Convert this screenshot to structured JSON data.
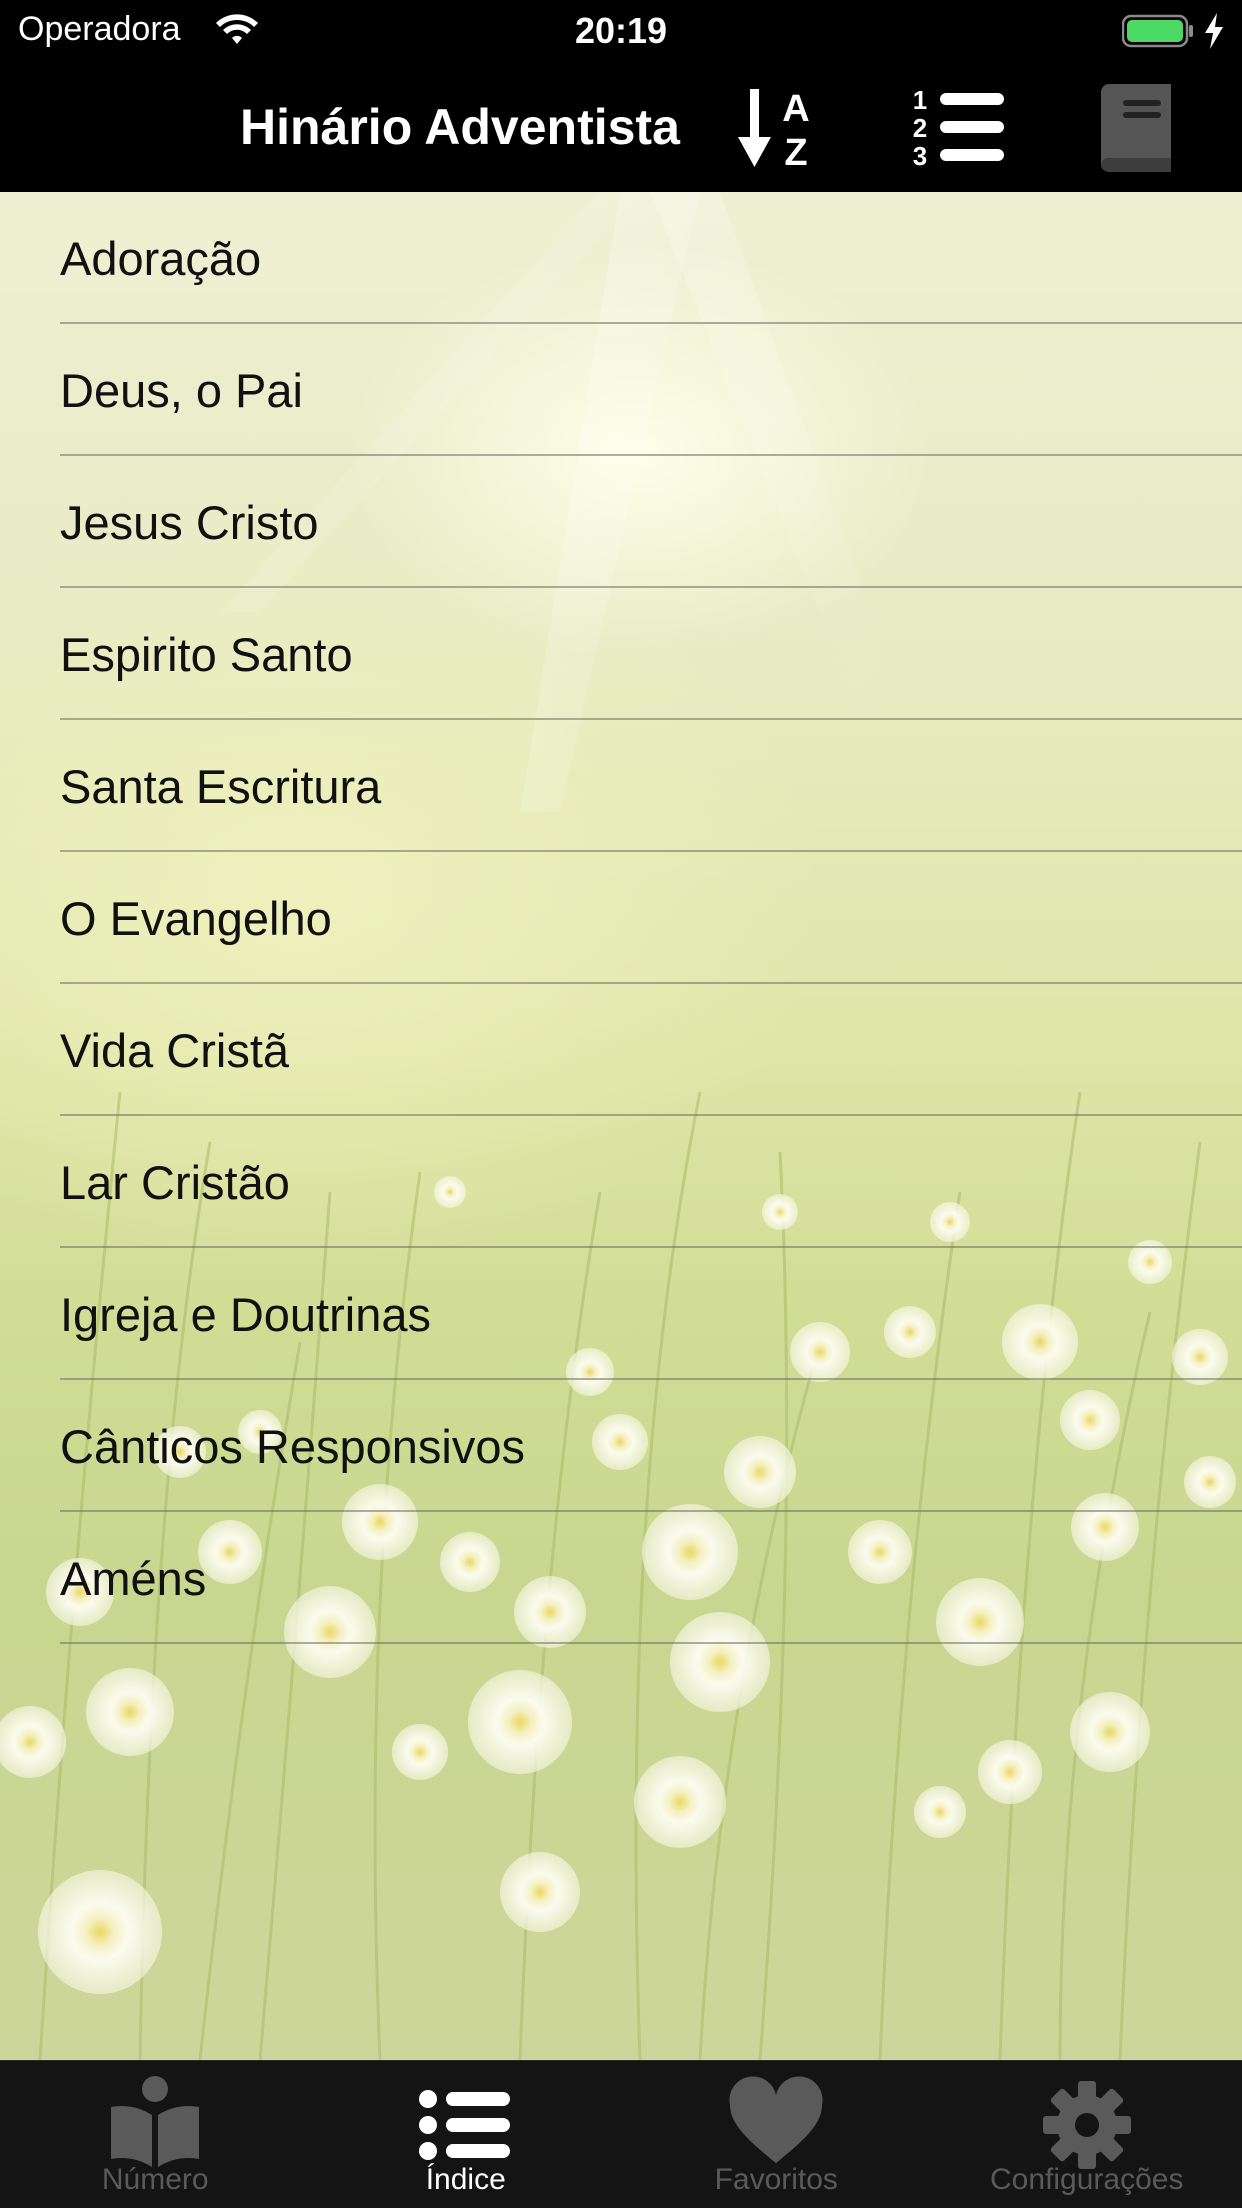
{
  "status_bar": {
    "carrier": "Operadora",
    "time": "20:19"
  },
  "nav": {
    "title": "Hinário Adventista",
    "sort_az_icon": "sort-alpha-icon",
    "sort_num_icon": "numbered-list-icon",
    "book_icon": "book-icon"
  },
  "categories": [
    {
      "label": "Adoração"
    },
    {
      "label": "Deus, o Pai"
    },
    {
      "label": "Jesus Cristo"
    },
    {
      "label": "Espirito Santo"
    },
    {
      "label": "Santa Escritura"
    },
    {
      "label": "O Evangelho"
    },
    {
      "label": "Vida Cristã"
    },
    {
      "label": "Lar Cristão"
    },
    {
      "label": "Igreja e Doutrinas"
    },
    {
      "label": "Cânticos Responsivos"
    },
    {
      "label": "Améns"
    }
  ],
  "tabs": [
    {
      "label": "Número",
      "icon": "open-book-icon",
      "active": false
    },
    {
      "label": "Índice",
      "icon": "list-icon",
      "active": true
    },
    {
      "label": "Favoritos",
      "icon": "heart-icon",
      "active": false
    },
    {
      "label": "Configurações",
      "icon": "gear-icon",
      "active": false
    }
  ],
  "colors": {
    "bar_background": "#000000",
    "tab_active": "#ffffff",
    "tab_inactive": "#5a5a5a",
    "battery": "#4cd964"
  }
}
